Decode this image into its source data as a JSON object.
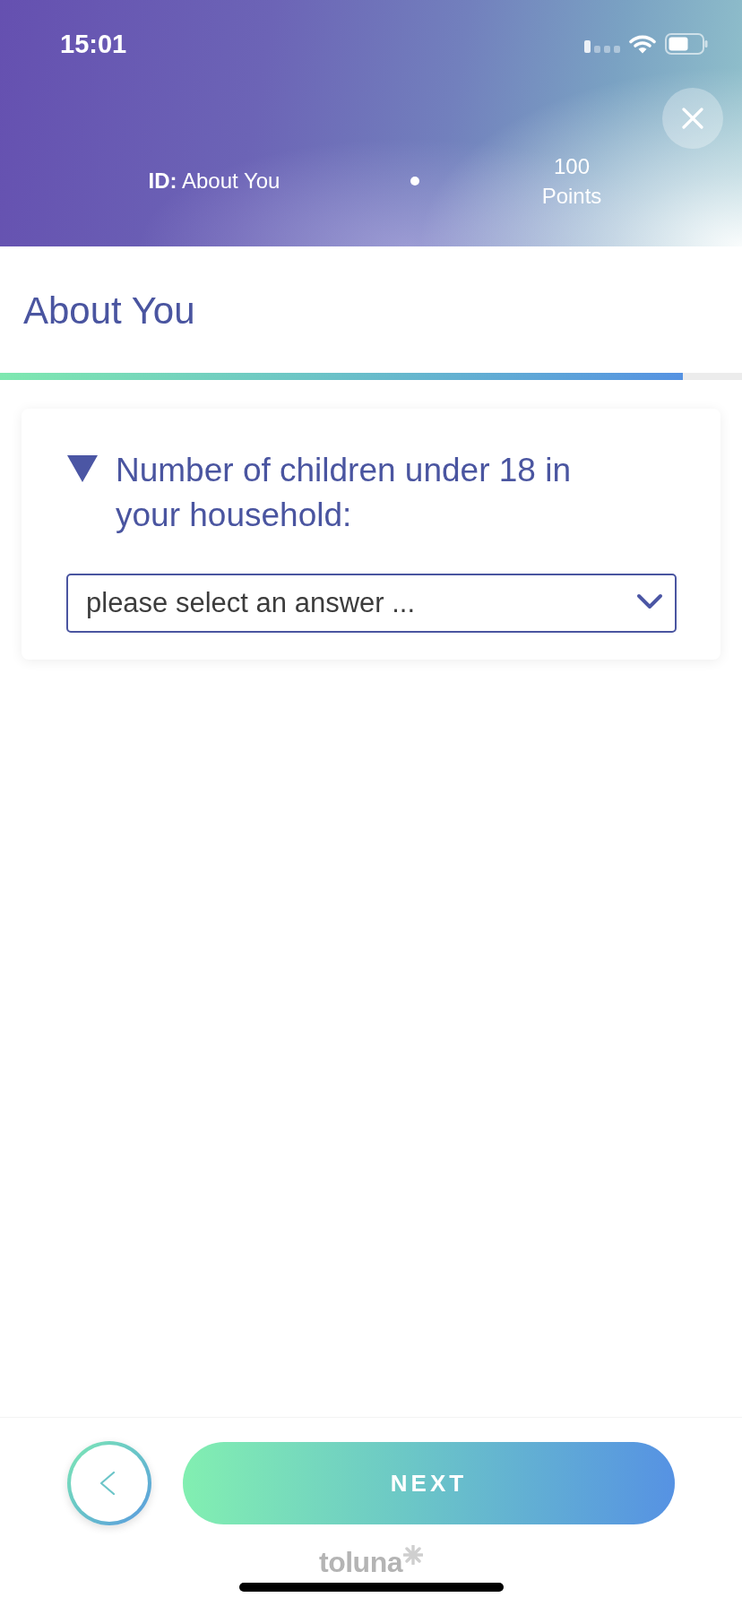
{
  "status_bar": {
    "time": "15:01"
  },
  "header": {
    "section": "**ID:** About You",
    "points_value": "100",
    "points_label": "Points"
  },
  "page_title": "About You",
  "progress": {
    "level": 0.92
  },
  "question": {
    "text": "Number of children under 18 in your household:",
    "select": {
      "placeholder": "please select an answer ..."
    }
  },
  "buttons": [
    {
      "kind": "back"
    },
    {
      "kind": "next",
      "label": "NEXT"
    }
  ],
  "footer": {
    "logo_text": "toluna"
  }
}
